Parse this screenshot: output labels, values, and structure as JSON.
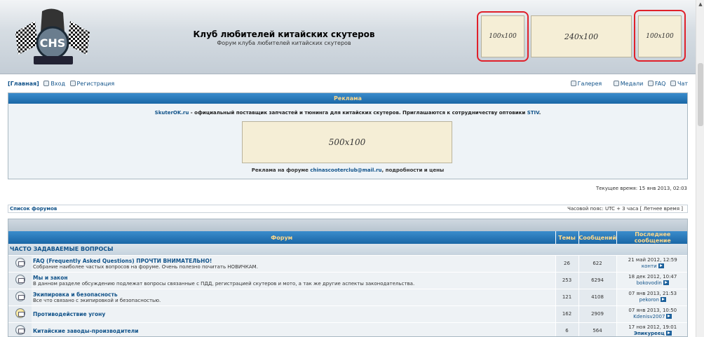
{
  "header": {
    "title": "Клуб любителей китайских скутеров",
    "subtitle": "Форум клуба любителей китайских скутеров",
    "logo_text": "CHS",
    "ad_small_1": "100x100",
    "ad_medium": "240x100",
    "ad_small_2": "100x100"
  },
  "nav": {
    "main": "[Главная]",
    "login": "Вход",
    "register": "Регистрация",
    "gallery": "Галерея",
    "medals": "Медали",
    "faq": "FAQ",
    "chat": "Чат"
  },
  "ads_panel": {
    "title": "Реклама",
    "sponsor_link": "SkuterOK.ru",
    "sponsor_text": " - официальный поставщик запчастей и тюнинга для китайских скутеров. Приглашаются к сотрудничеству оптовики ",
    "sponsor_link2": "STIV",
    "sponsor_end": ".",
    "banner": "500x100",
    "contact_prefix": "Реклама на форуме ",
    "contact_link": "chinascooterclub@mail.ru",
    "contact_suffix": ", подробности и цены"
  },
  "current_time": "Текущее время: 15 янв 2013, 02:03",
  "forum_list": {
    "label": "Список форумов",
    "timezone": "Часовой пояс: UTC + 3 часа [ Летнее время ]"
  },
  "table": {
    "headers": {
      "forum": "Форум",
      "topics": "Темы",
      "posts": "Сообщений",
      "last_post": "Последнее сообщение"
    },
    "category": "ЧАСТО ЗАДАВАЕМЫЕ ВОПРОСЫ",
    "rows": [
      {
        "name": "FAQ (Frequently Asked Questions) ПРОЧТИ ВНИМАТЕЛЬНО!",
        "desc": "Собрание наиболее частых вопросов на форуме. Очень полезно почитать НОВИЧКАМ.",
        "topics": "26",
        "posts": "622",
        "last_date": "21 май 2012, 12:59",
        "last_user": "конти"
      },
      {
        "name": "Мы и закон",
        "desc": "В данном разделе обсуждению подлежат вопросы связанные с ПДД, регистрацией скутеров и мото, а так же другие аспекты законодательства.",
        "topics": "253",
        "posts": "6294",
        "last_date": "18 дек 2012, 10:47",
        "last_user": "bokovodin"
      },
      {
        "name": "Экипировка и безопасность",
        "desc": "Все что связано с экипировкой и безопасностью.",
        "topics": "121",
        "posts": "4108",
        "last_date": "07 янв 2013, 21:53",
        "last_user": "pekoron"
      },
      {
        "name": "Противодействие угону",
        "desc": "",
        "topics": "162",
        "posts": "2909",
        "last_date": "07 янв 2013, 10:50",
        "last_user": "Kdenisv2007"
      },
      {
        "name": "Китайские заводы-производители",
        "desc": "",
        "topics": "6",
        "posts": "564",
        "last_date": "17 ноя 2012, 19:01",
        "last_user": "Эпикуреец"
      }
    ]
  }
}
